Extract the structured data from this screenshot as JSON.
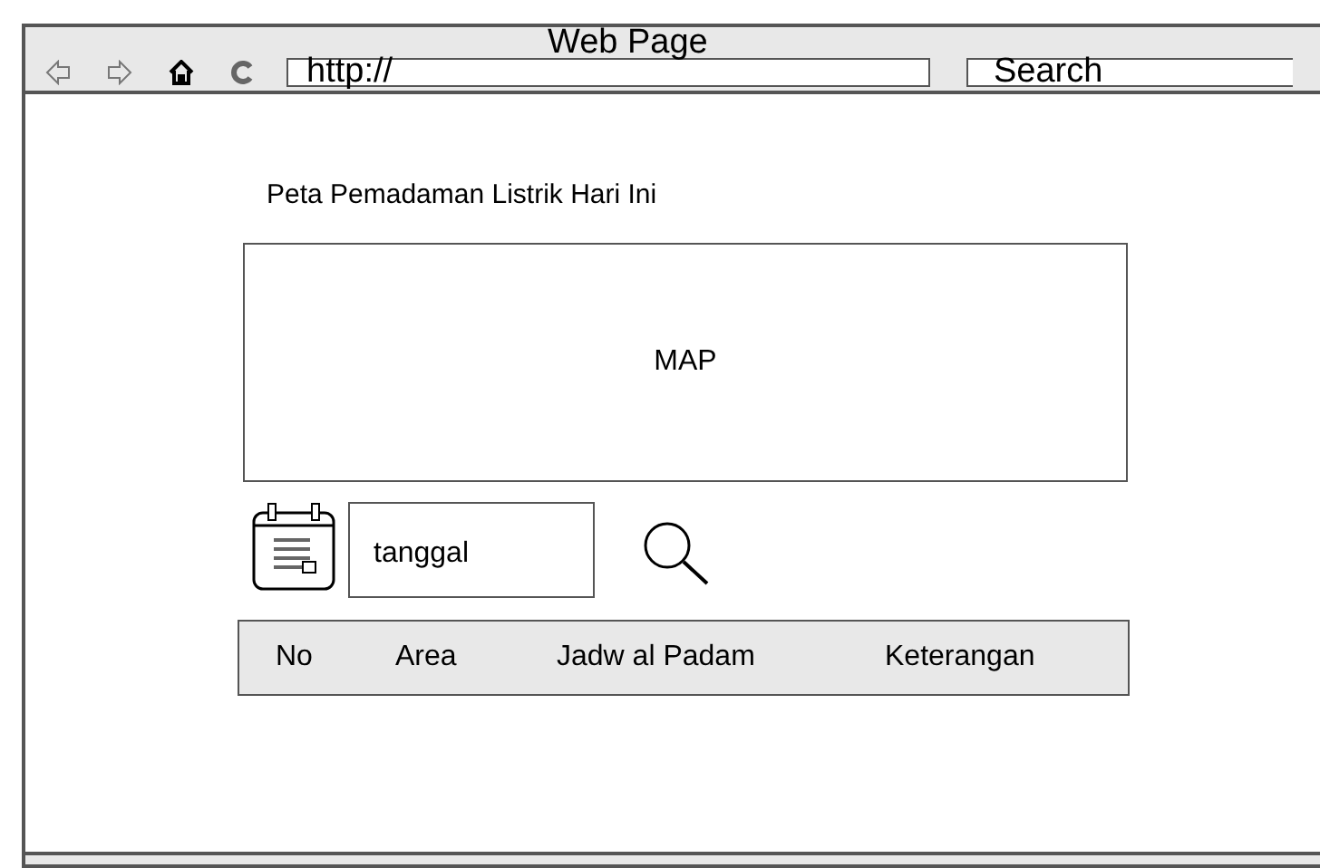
{
  "window": {
    "title": "Web Page"
  },
  "toolbar": {
    "url_field": {
      "value": "http://"
    },
    "search_field": {
      "value": "Search"
    }
  },
  "heading": "Peta Pemadaman Listrik Hari Ini",
  "map": {
    "label": "MAP"
  },
  "date_field": {
    "value": "tanggal"
  },
  "table": {
    "columns": [
      "No",
      "Area",
      "Jadw al Padam",
      "Keterangan"
    ]
  }
}
